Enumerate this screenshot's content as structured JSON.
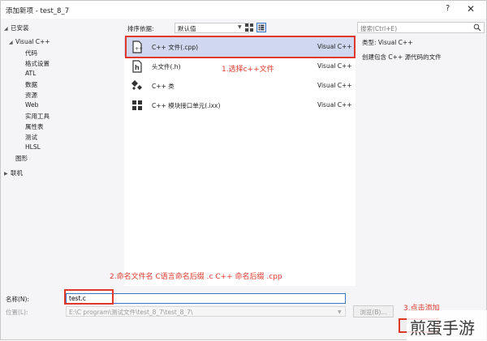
{
  "window": {
    "title": "添加新项 - test_8_7",
    "help_glyph": "?",
    "close_glyph": "✕"
  },
  "tree": {
    "installed": "已安装",
    "root": "Visual C++",
    "children": [
      "代码",
      "格式设置",
      "ATL",
      "数据",
      "资源",
      "Web",
      "实用工具",
      "属性表",
      "测试",
      "HLSL"
    ],
    "graphics": "图形",
    "online": "联机"
  },
  "toolbar": {
    "sort_label": "排序依据:",
    "sort_value": "默认值"
  },
  "templates": [
    {
      "name": "C++ 文件(.cpp)",
      "lang": "Visual C++",
      "icon": "cpp-file-icon",
      "selected": true
    },
    {
      "name": "头文件(.h)",
      "lang": "Visual C++",
      "icon": "header-file-icon",
      "selected": false
    },
    {
      "name": "C++ 类",
      "lang": "Visual C++",
      "icon": "cpp-class-icon",
      "selected": false
    },
    {
      "name": "C++ 模块接口单元(.ixx)",
      "lang": "Visual C++",
      "icon": "module-interface-icon",
      "selected": false
    }
  ],
  "search": {
    "placeholder": "搜索(Ctrl+E)"
  },
  "info": {
    "type": "类型: Visual C++",
    "description": "创建包含 C++ 源代码的文件"
  },
  "annotations": {
    "step1": "1.选择c++文件",
    "step2": "2.命名文件名 C语言命名后缀 .c  C++ 命名后缀 .cpp",
    "step3": "3.点击添加",
    "color": "#e0392b"
  },
  "bottom": {
    "name_label": "名称(N):",
    "name_value": "test.c",
    "location_label": "位置(L):",
    "location_value": "E:\\C   program\\测试文件\\test_8_7\\test_8_7\\",
    "browse_label": "浏览(B)..."
  },
  "watermark": "煎蛋手游"
}
